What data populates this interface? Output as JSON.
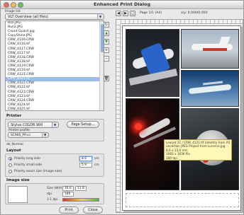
{
  "window": {
    "title": "Enhanced Print Dialog"
  },
  "images_panel": {
    "label": "Image list",
    "filter_value": "VLT Overview (all files)",
    "files": [
      "Run.JPG",
      "Run2.JPG",
      "Count Guard.jpg",
      "CopyShine.JPG",
      "CRW_4116.CRW",
      "CRW_4116.tif",
      "CRW_4117.CRW",
      "CRW_4117.tif",
      "CRW_4118.CRW",
      "CRW_4118.tif",
      "CRW_4119.CRW",
      "CRW_4119.tif",
      "CRW_4121.CRW",
      "CRW_4121.tif",
      "CRW_4122.CRW",
      "CRW_4122.tif",
      "CRW_4123.CRW",
      "CRW_4123.tif",
      "CRW_4124.CRW",
      "CRW_4124.tif",
      "CRW_4125.tif"
    ],
    "selected_index": 13
  },
  "printer": {
    "section": "Printer",
    "printer_value": "Stylus COLOR 900",
    "page_setup_label": "Page Setup...",
    "profile_label": "Printer profile",
    "profile_value": "SC900_PP.icc",
    "extra_value": "de_Normal"
  },
  "layout": {
    "section": "Layout",
    "priority_long_label": "Priority long side",
    "priority_small_label": "Priority small side",
    "priority_exact_label": "Priority exact size (image size)",
    "long_value": "8.6",
    "small_value": "5.9",
    "unit": "cm"
  },
  "image_size": {
    "section": "Image size",
    "size_label": "Size (W/H)",
    "width_value": "16.6",
    "height_value": "11.8",
    "res_label": "dpi",
    "res_value": "180",
    "quality_label": "1:1 dpi"
  },
  "buttons": {
    "print": "Print",
    "close": "Close"
  },
  "toolbar": {
    "page_label": "Page 1/1 (A4)",
    "zoom_label": "x/y: 0.000/0.000"
  },
  "tooltip": {
    "line1": "Learjet 31 / CRW_4121.tif (identity from A5)",
    "line2": "uncertain JPEG Project from Lucerne.jpg",
    "line3": "8.6 x 13.0 mm",
    "line4": "1083 x 1636 Pix",
    "line5": "180 dpi"
  }
}
